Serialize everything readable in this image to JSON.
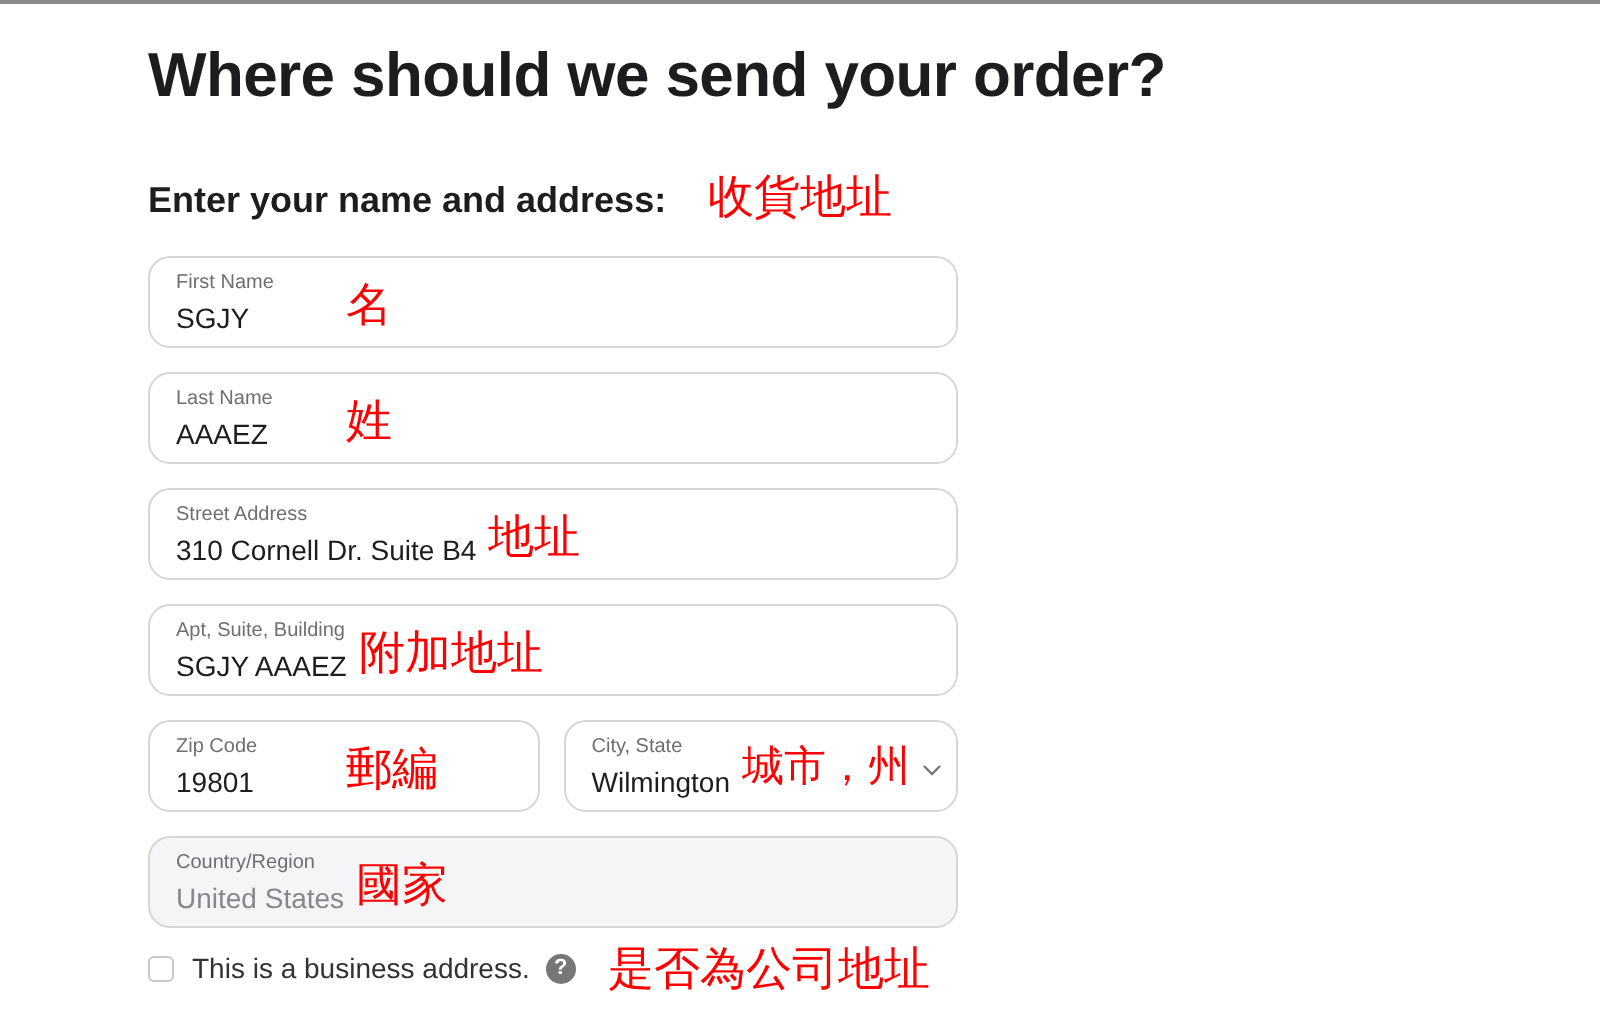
{
  "title": "Where should we send your order?",
  "section": {
    "heading": "Enter your name and address:",
    "annotation": "收貨地址"
  },
  "rows": [
    {
      "fields": [
        {
          "kind": "text",
          "label": "First Name",
          "value": "SGJY",
          "annotation": "名",
          "disabled": false
        }
      ]
    },
    {
      "fields": [
        {
          "kind": "text",
          "label": "Last Name",
          "value": "AAAEZ",
          "annotation": "姓",
          "disabled": false
        }
      ]
    },
    {
      "fields": [
        {
          "kind": "text",
          "label": "Street Address",
          "value": "310 Cornell Dr. Suite B4",
          "annotation": "地址",
          "disabled": false
        }
      ]
    },
    {
      "fields": [
        {
          "kind": "text",
          "label": "Apt, Suite, Building",
          "value": "SGJY AAAEZ",
          "annotation": "附加地址",
          "disabled": false
        }
      ]
    },
    {
      "fields": [
        {
          "kind": "text",
          "label": "Zip Code",
          "value": "19801",
          "annotation": "郵編",
          "disabled": false
        },
        {
          "kind": "select",
          "label": "City, State",
          "value": "Wilmington",
          "annotation": "城市，州",
          "disabled": false
        }
      ]
    },
    {
      "fields": [
        {
          "kind": "text",
          "label": "Country/Region",
          "value": "United States",
          "annotation": "國家",
          "disabled": true
        }
      ]
    }
  ],
  "business": {
    "label": "This is a business address.",
    "checked": false,
    "help": "?",
    "annotation": "是否為公司地址"
  }
}
